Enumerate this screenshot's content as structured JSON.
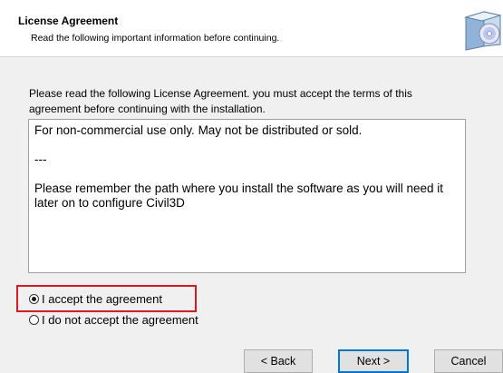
{
  "header": {
    "title": "License Agreement",
    "subtitle": "Read the following important information before continuing."
  },
  "intro": "Please read the following License Agreement. you must accept the terms of this agreement before continuing with the installation.",
  "license_text": {
    "line1": "For non-commercial use only. May not be distributed or sold.",
    "line2": "---",
    "line3": "Please remember the path where you install the software as you will need it later on to configure Civil3D"
  },
  "options": {
    "accept": "I accept the agreement",
    "decline": "I do not accept the agreement",
    "selected": "accept"
  },
  "buttons": {
    "back": "< Back",
    "next": "Next >",
    "cancel": "Cancel"
  },
  "colors": {
    "highlight": "#e0191e",
    "default_button_border": "#0078d7"
  }
}
